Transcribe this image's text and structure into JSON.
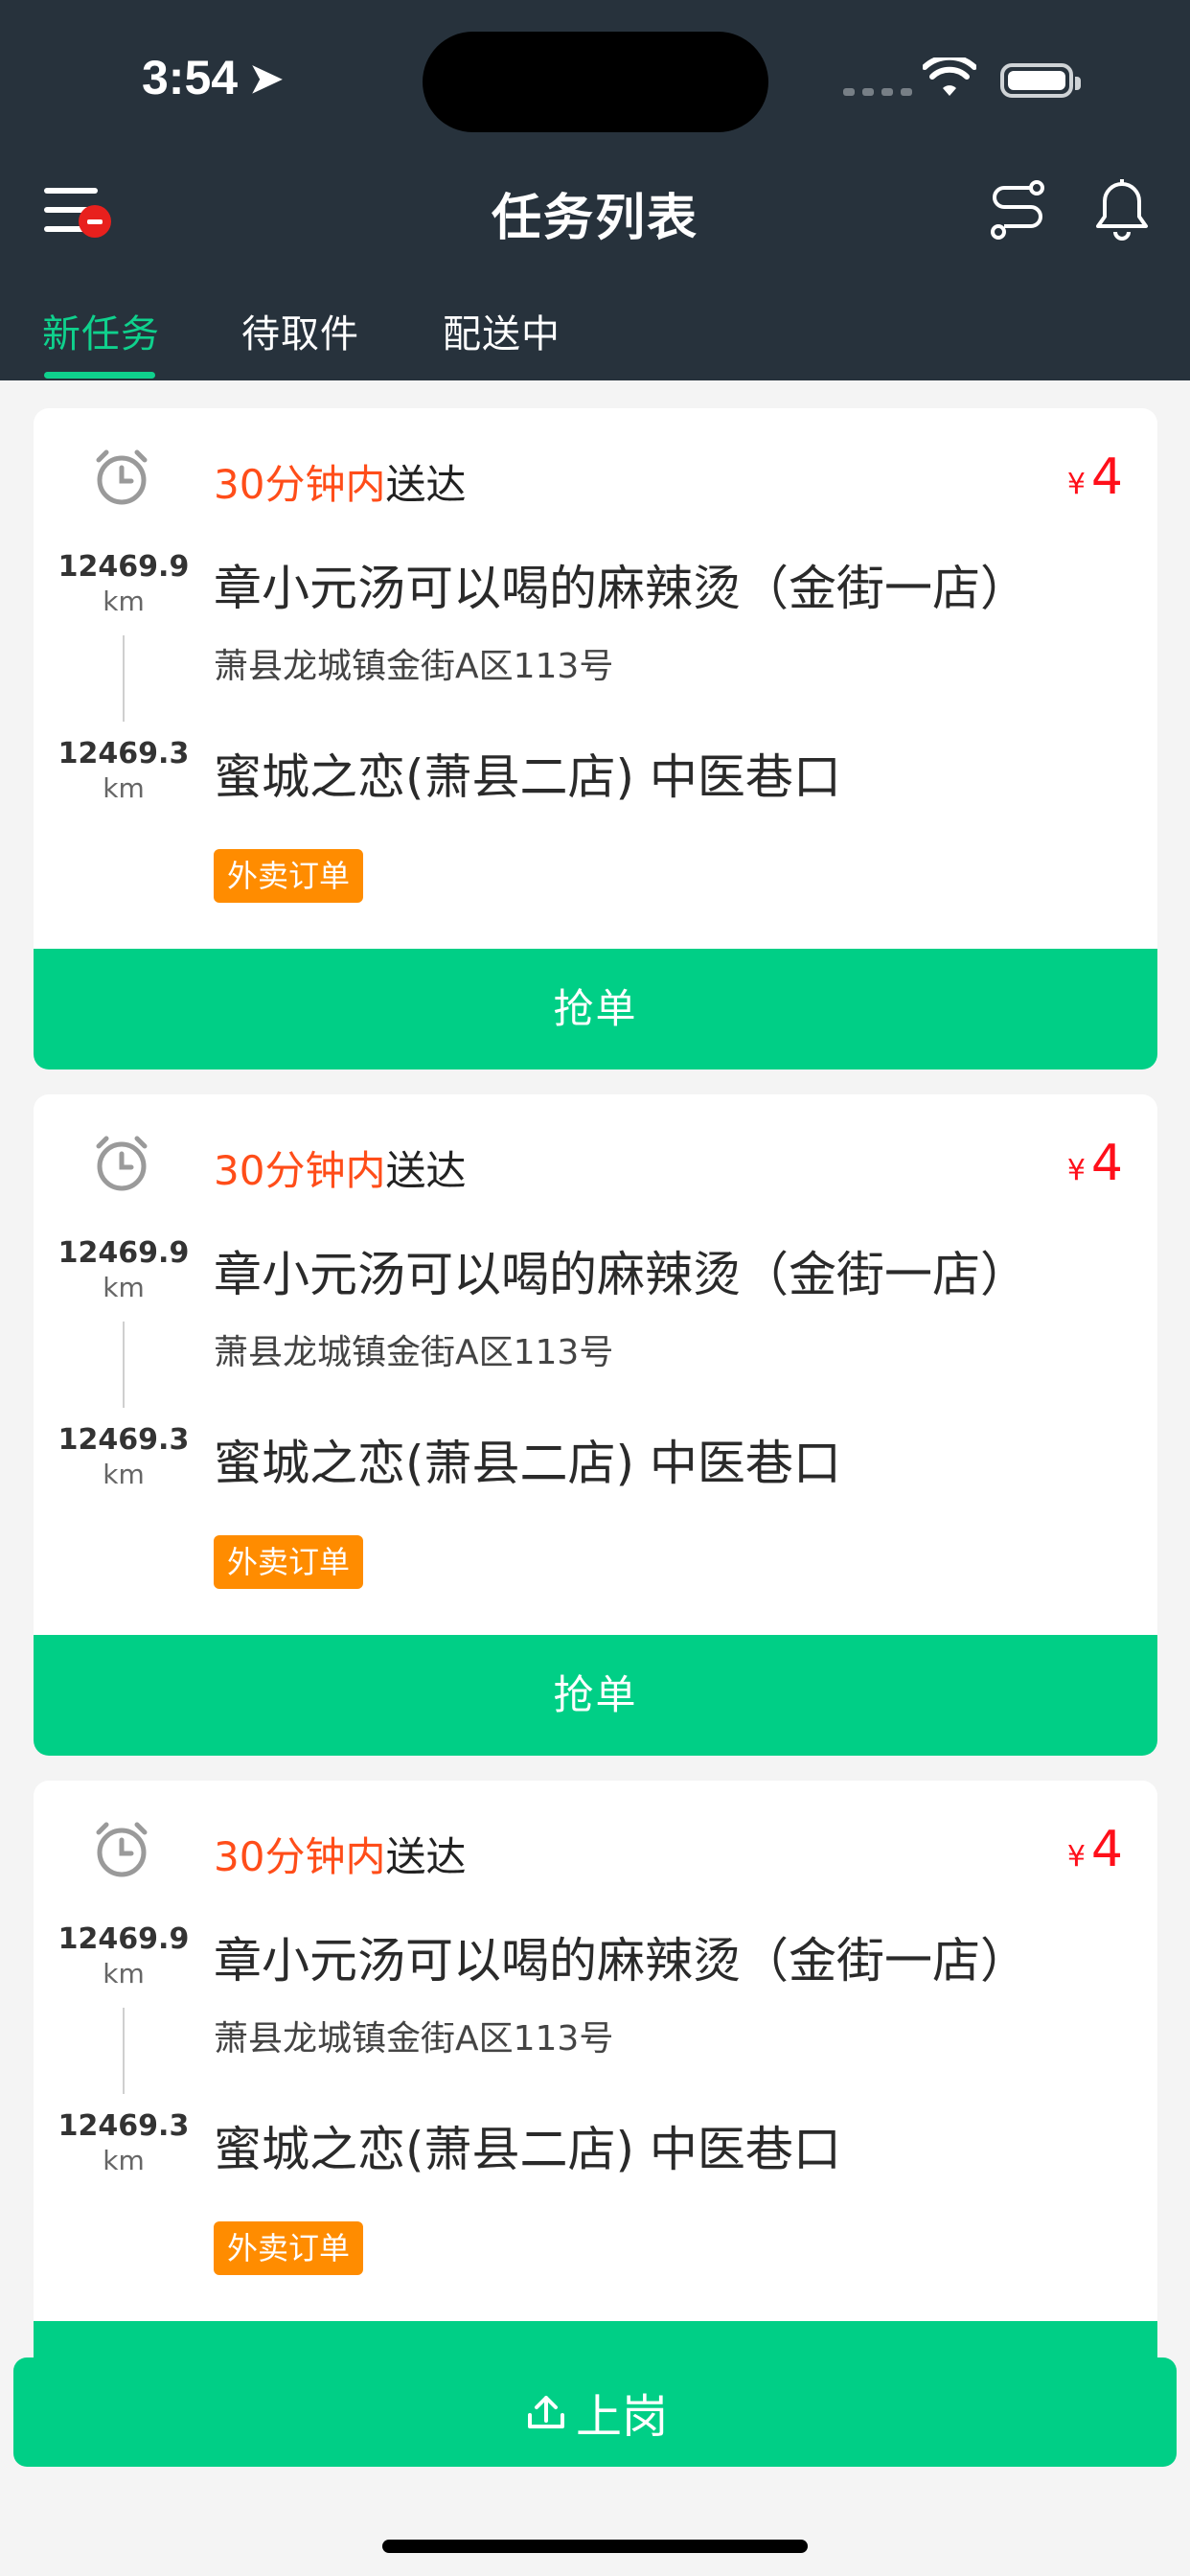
{
  "status_bar": {
    "time": "3:54"
  },
  "header": {
    "title": "任务列表",
    "tabs": [
      {
        "label": "新任务",
        "active": true
      },
      {
        "label": "待取件",
        "active": false
      },
      {
        "label": "配送中",
        "active": false
      }
    ]
  },
  "orders": [
    {
      "deliver_highlight": "30分钟内",
      "deliver_suffix": "送达",
      "currency": "¥",
      "price": "4",
      "pickup_distance": "12469.9",
      "pickup_unit": "km",
      "store_name": "章小元汤可以喝的麻辣烫（金街一店）",
      "store_address": "萧县龙城镇金街A区113号",
      "dropoff_distance": "12469.3",
      "dropoff_unit": "km",
      "destination": "蜜城之恋(萧县二店) 中医巷口",
      "tag": "外卖订单",
      "action": "抢单"
    },
    {
      "deliver_highlight": "30分钟内",
      "deliver_suffix": "送达",
      "currency": "¥",
      "price": "4",
      "pickup_distance": "12469.9",
      "pickup_unit": "km",
      "store_name": "章小元汤可以喝的麻辣烫（金街一店）",
      "store_address": "萧县龙城镇金街A区113号",
      "dropoff_distance": "12469.3",
      "dropoff_unit": "km",
      "destination": "蜜城之恋(萧县二店) 中医巷口",
      "tag": "外卖订单",
      "action": "抢单"
    },
    {
      "deliver_highlight": "30分钟内",
      "deliver_suffix": "送达",
      "currency": "¥",
      "price": "4",
      "pickup_distance": "12469.9",
      "pickup_unit": "km",
      "store_name": "章小元汤可以喝的麻辣烫（金街一店）",
      "store_address": "萧县龙城镇金街A区113号",
      "dropoff_distance": "12469.3",
      "dropoff_unit": "km",
      "destination": "蜜城之恋(萧县二店) 中医巷口",
      "tag": "外卖订单",
      "action": "抢单"
    }
  ],
  "footer": {
    "shift_label": "上岗"
  },
  "colors": {
    "header_bg": "#27323c",
    "accent_green": "#00cf86",
    "highlight_orange": "#ff4d19",
    "price_red": "#ff0f1a",
    "tag_orange": "#ff8c00"
  },
  "icons": [
    "menu-icon",
    "route-icon",
    "bell-icon",
    "alarm-clock-icon",
    "upload-icon"
  ]
}
